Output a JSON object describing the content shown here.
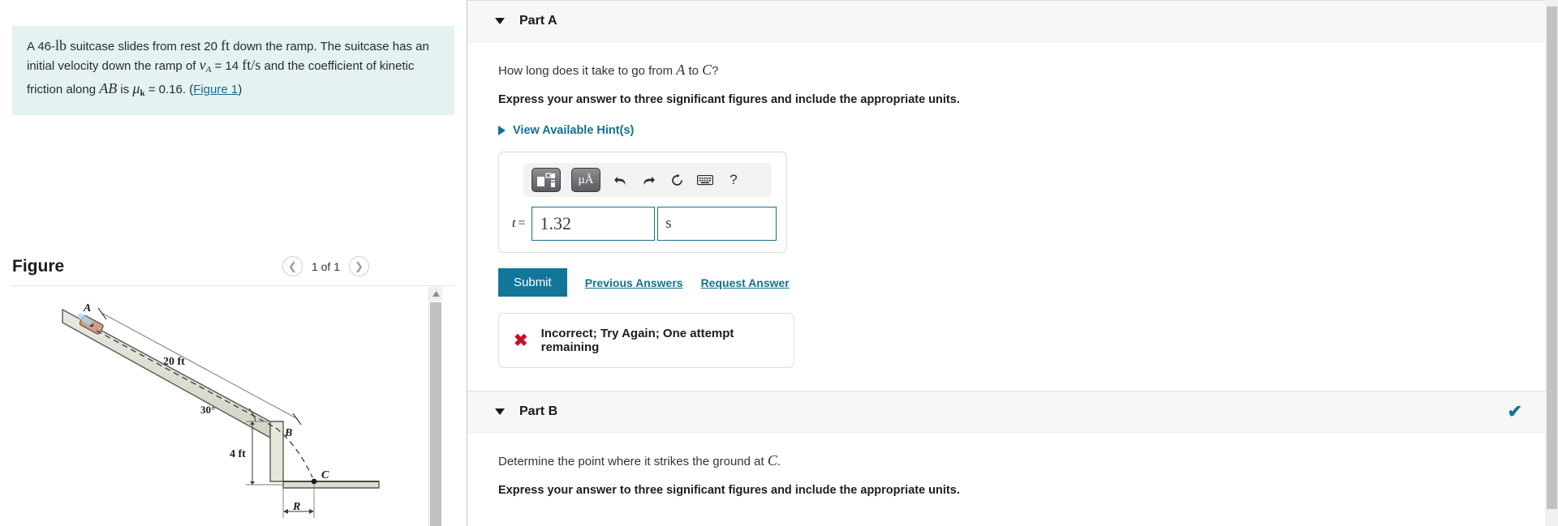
{
  "problem": {
    "text_parts": {
      "p1": "A 46-",
      "unit_lb": "lb",
      "p2": " suitcase slides from rest 20 ",
      "unit_ft": "ft",
      "p3": " down the ramp. The suitcase has an initial velocity down the ramp of ",
      "v_sym": "v",
      "v_sub": "A",
      "p4": " = 14 ",
      "unit_fts": "ft/s",
      "p5": " and the coefficient of kinetic friction along ",
      "ab": "AB",
      "p6": " is ",
      "mu_sym": "μ",
      "mu_sub": "k",
      "p7": " = 0.16. (",
      "figure_link": "Figure 1",
      "p8": ")"
    }
  },
  "figure_panel": {
    "title": "Figure",
    "count_label": "1 of 1",
    "prev_icon": "chevron-left-icon",
    "next_icon": "chevron-right-icon",
    "diagram": {
      "label_A": "A",
      "label_B": "B",
      "label_C": "C",
      "label_R": "R",
      "dim_ramp": "20 ft",
      "dim_drop": "4 ft",
      "angle": "30°"
    }
  },
  "part_a": {
    "title": "Part A",
    "caret_icon": "caret-down-icon",
    "question": {
      "pre": "How long does it take to go from ",
      "sym_a": "A",
      "mid": " to ",
      "sym_c": "C",
      "post": "?"
    },
    "instruction": "Express your answer to three significant figures and include the appropriate units.",
    "hints_label": "View Available Hint(s)",
    "hints_icon": "triangle-right-icon",
    "math_toolbar": [
      {
        "name": "template-icon",
        "label": "■□",
        "type": "dark"
      },
      {
        "name": "units-icon",
        "label": "μÅ",
        "type": "dark"
      },
      {
        "name": "undo-icon",
        "label": "↶",
        "type": "plain"
      },
      {
        "name": "redo-icon",
        "label": "↷",
        "type": "plain"
      },
      {
        "name": "reset-icon",
        "label": "↻",
        "type": "plain"
      },
      {
        "name": "keyboard-icon",
        "label": "⌨",
        "type": "plain"
      },
      {
        "name": "help-icon",
        "label": "?",
        "type": "plain"
      }
    ],
    "answer": {
      "variable": "t",
      "equals": "=",
      "value": "1.32",
      "unit": "s"
    },
    "submit_label": "Submit",
    "previous_answers_label": "Previous Answers",
    "request_answer_label": "Request Answer",
    "feedback": {
      "icon": "x-mark-icon",
      "text": "Incorrect; Try Again; One attempt remaining"
    }
  },
  "part_b": {
    "title": "Part B",
    "caret_icon": "caret-down-icon",
    "status_icon": "checkmark-icon",
    "question": {
      "pre": "Determine the point where it strikes the ground at ",
      "sym_c": "C",
      "post": "."
    },
    "instruction": "Express your answer to three significant figures and include the appropriate units."
  },
  "colors": {
    "accent": "#11769a",
    "problem_bg": "#e4f2f2",
    "error": "#c8102e"
  }
}
